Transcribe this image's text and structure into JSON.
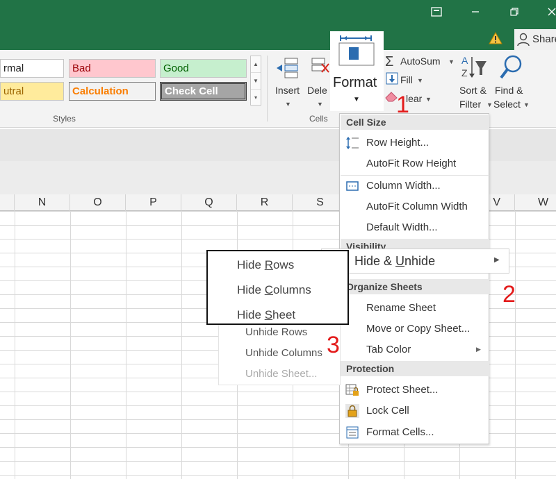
{
  "ribbon": {
    "styles": {
      "normal": "rmal",
      "bad": "Bad",
      "good": "Good",
      "neutral": "utral",
      "calculation": "Calculation",
      "check_cell": "Check Cell",
      "group_label": "Styles"
    },
    "cells": {
      "insert": "Insert",
      "delete": "Dele",
      "format": "Format",
      "group_label": "Cells"
    },
    "editing": {
      "autosum": "AutoSum",
      "fill": "Fill",
      "clear": "lear",
      "sort_filter_line1": "Sort &",
      "sort_filter_line2": "Filter",
      "find_select_line1": "Find &",
      "find_select_line2": "Select"
    },
    "share": "Share"
  },
  "columns": [
    "N",
    "O",
    "P",
    "Q",
    "R",
    "S",
    "V",
    "W"
  ],
  "format_menu": {
    "cell_size": "Cell Size",
    "row_height": "Row Height...",
    "autofit_row_height": "AutoFit Row Height",
    "column_width": "Column Width...",
    "autofit_column_width": "AutoFit Column Width",
    "default_width": "Default Width...",
    "visibility": "Visibility",
    "hide_unhide": "Hide & Unhide",
    "organize_sheets": "Organize Sheets",
    "rename_sheet": "Rename Sheet",
    "move_copy_sheet": "Move or Copy Sheet...",
    "tab_color": "Tab Color",
    "protection": "Protection",
    "protect_sheet": "Protect Sheet...",
    "lock_cell": "Lock Cell",
    "format_cells": "Format Cells..."
  },
  "submenu": {
    "hide_rows": "Hide Rows",
    "hide_columns": "Hide Columns",
    "hide_sheet": "Hide Sheet",
    "unhide_rows": "Unhide Rows",
    "unhide_columns": "Unhide Columns",
    "unhide_sheet": "Unhide Sheet..."
  },
  "steps": {
    "one": "1",
    "two": "2",
    "three": "3"
  },
  "colors": {
    "excel_green": "#217346",
    "step_red": "#e31b1b"
  }
}
